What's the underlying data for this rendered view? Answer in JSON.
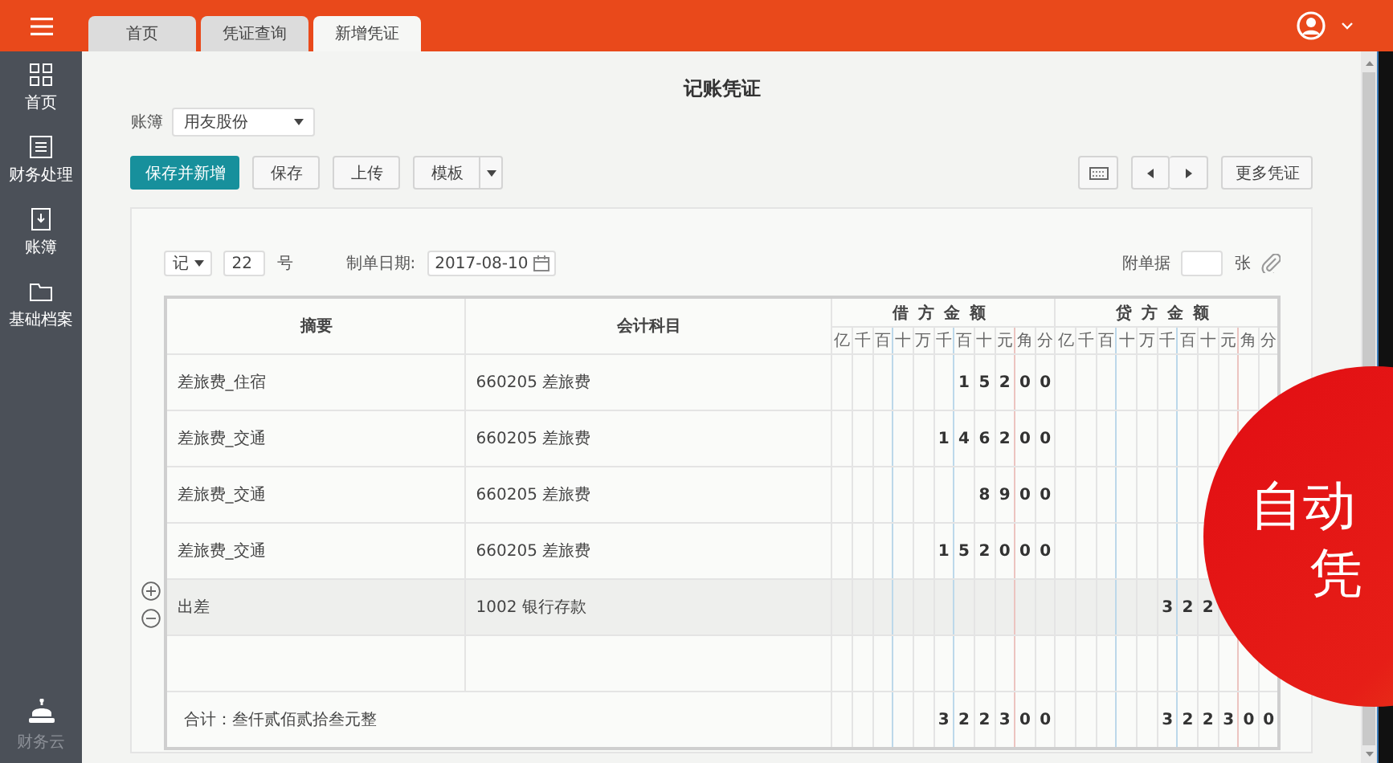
{
  "header": {
    "tabs": [
      {
        "label": "首页",
        "selected": false
      },
      {
        "label": "凭证查询",
        "selected": false
      },
      {
        "label": "新增凭证",
        "selected": true
      }
    ]
  },
  "sidebar": {
    "items": [
      {
        "label": "首页"
      },
      {
        "label": "财务处理"
      },
      {
        "label": "账簿"
      },
      {
        "label": "基础档案"
      }
    ],
    "footer": {
      "label": "财务云"
    }
  },
  "page": {
    "title": "记账凭证",
    "ledger": {
      "label": "账簿",
      "value": "用友股份"
    },
    "toolbar": [
      {
        "label": "保存并新增",
        "kind": "primary"
      },
      {
        "label": "保存",
        "kind": "default"
      },
      {
        "label": "上传",
        "kind": "default"
      },
      {
        "label": "模板",
        "kind": "split"
      }
    ],
    "more_button": "更多凭证"
  },
  "voucher": {
    "type": "记",
    "number": "22",
    "number_suffix": "号",
    "date_label": "制单日期:",
    "date": "2017-08-10",
    "attachments_label": "附单据",
    "attachments_suffix": "张",
    "columns": [
      "摘要",
      "会计科目"
    ],
    "debit_header": "借方金额",
    "credit_header": "贷方金额",
    "debit_units": [
      "亿",
      "千",
      "百",
      "十",
      "万",
      "千",
      "百",
      "十",
      "元",
      "角",
      "分"
    ],
    "credit_units": [
      "亿",
      "千",
      "百",
      "十",
      "万",
      "千",
      "百",
      "十",
      "元",
      "角",
      "分"
    ],
    "rows": [
      {
        "summary": "差旅费_住宿",
        "account": "660205 差旅费",
        "debit": [
          "1",
          "5",
          "2",
          "0",
          "0"
        ],
        "selected": false
      },
      {
        "summary": "差旅费_交通",
        "account": "660205 差旅费",
        "debit": [
          "1",
          "4",
          "6",
          "2",
          "0",
          "0"
        ],
        "selected": false
      },
      {
        "summary": "差旅费_交通",
        "account": "660205 差旅费",
        "debit": [
          "8",
          "9",
          "0",
          "0"
        ],
        "selected": false
      },
      {
        "summary": "差旅费_交通",
        "account": "660205 差旅费",
        "debit": [
          "1",
          "5",
          "2",
          "0",
          "0",
          "0"
        ],
        "selected": false
      },
      {
        "summary": "出差",
        "account": "1002 银行存款",
        "credit": [
          "3",
          "2",
          "2"
        ],
        "credit_partial": true,
        "selected": true
      },
      {
        "selected": false
      }
    ],
    "total": {
      "label": "合计：叁仟贰佰贰拾叁元整",
      "debit": [
        "3",
        "2",
        "2",
        "3",
        "0",
        "0"
      ],
      "credit": [
        "3",
        "2",
        "2",
        "3",
        "0",
        "0"
      ]
    }
  },
  "overlay": {
    "lines": [
      "自动",
      "凭"
    ]
  }
}
